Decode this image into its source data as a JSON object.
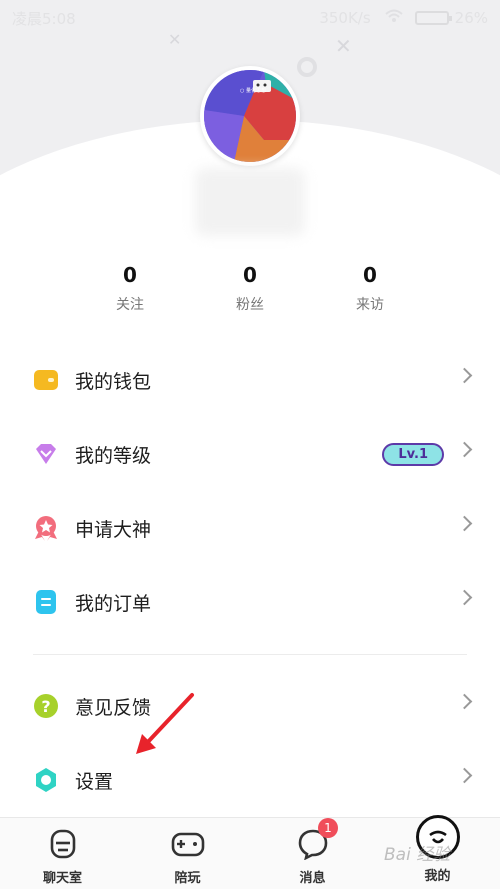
{
  "status_bar": {
    "time": "凌晨5:08",
    "speed": "350K/s",
    "battery": "26%"
  },
  "profile": {
    "avatar_caption": "○ 量化思想"
  },
  "stats": [
    {
      "value": "0",
      "label": "关注"
    },
    {
      "value": "0",
      "label": "粉丝"
    },
    {
      "value": "0",
      "label": "来访"
    }
  ],
  "menu": {
    "wallet": "我的钱包",
    "level": "我的等级",
    "level_badge": "Lv.1",
    "apply": "申请大神",
    "orders": "我的订单",
    "feedback": "意见反馈",
    "settings": "设置"
  },
  "bottom_nav": {
    "chat": "聊天室",
    "play": "陪玩",
    "messages": "消息",
    "messages_badge": "1",
    "mine": "我的"
  },
  "watermark": "Bai 经验",
  "colors": {
    "wallet": "#f5b921",
    "level": "#c77dea",
    "apply": "#f26d7d",
    "orders": "#2ec4ee",
    "feedback": "#a7d12b",
    "settings": "#2fd3c4",
    "arrow": "#e8232b"
  }
}
